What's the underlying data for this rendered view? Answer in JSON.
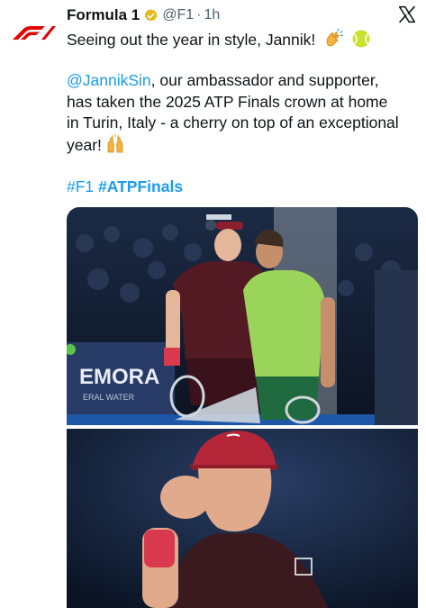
{
  "tweet": {
    "author_name": "Formula 1",
    "handle": "@F1",
    "separator": "·",
    "time": "1h",
    "line1": "Seeing out the year in style, Jannik!",
    "mention": "@JannikSin",
    "para2_rest": ", our ambassador and supporter,",
    "para2_line2": "has taken the 2025 ATP Finals crown at home",
    "para2_line3": "in Turin, Italy - a cherry on top of an exceptional",
    "para2_line4": "year!",
    "hashtags": [
      "#F1",
      "#ATPFinals"
    ]
  },
  "media": {
    "photo1_banner_text": "EMORA",
    "photo1_banner_subtext": "ERAL WATER"
  },
  "icons": {
    "avatar": "f1-logo-icon",
    "verified": "verified-badge-icon",
    "close": "x-logo-icon",
    "emoji1": "clapping-hands-icon",
    "emoji2": "tennis-ball-icon",
    "emoji3": "raising-hands-icon"
  },
  "colors": {
    "brand_red": "#e10600",
    "link_blue": "#1d9bf0",
    "text": "#0f1419",
    "secondary": "#536471",
    "verified_gold": "#e2b719"
  }
}
